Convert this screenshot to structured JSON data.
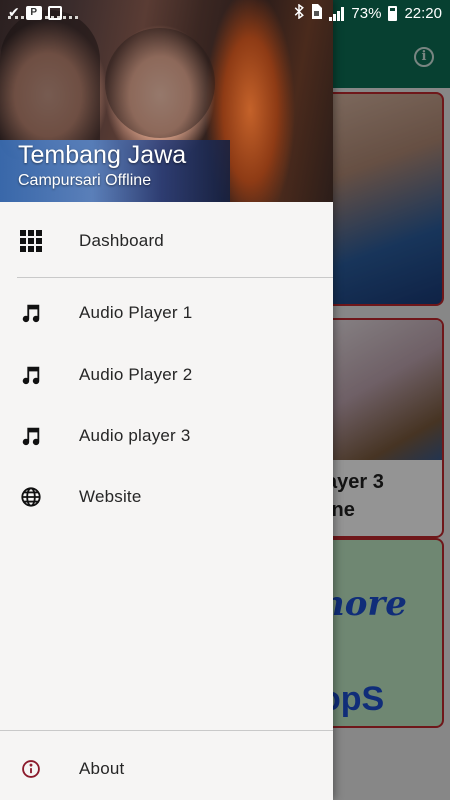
{
  "status_bar": {
    "battery": "73%",
    "time": "22:20",
    "left_icons": [
      "check-icon",
      "p-box-icon",
      "image-icon"
    ],
    "right_icons": [
      "bluetooth-icon",
      "sim-icon",
      "signal-icon",
      "battery-icon"
    ]
  },
  "drawer": {
    "header": {
      "title": "Tembang Jawa",
      "subtitle": "Campursari Offline"
    },
    "items": [
      {
        "label": "Dashboard",
        "icon": "grid-icon"
      },
      {
        "label": "Audio Player 1",
        "icon": "music-note-icon"
      },
      {
        "label": "Audio Player 2",
        "icon": "music-note-icon"
      },
      {
        "label": "Audio player 3",
        "icon": "music-note-icon"
      },
      {
        "label": "Website",
        "icon": "globe-icon"
      }
    ],
    "footer_item": {
      "label": "About",
      "icon": "info-icon"
    }
  },
  "background": {
    "card2_text": "ayer 3\nine",
    "card3_text_top": "nore",
    "card3_text_bottom": "opS",
    "info_button": "i"
  },
  "colors": {
    "app_bar": "#0d6f55",
    "drawer_bg": "#f6f5f4",
    "card_border": "#c0282d",
    "about_icon": "#8b1a2b"
  }
}
